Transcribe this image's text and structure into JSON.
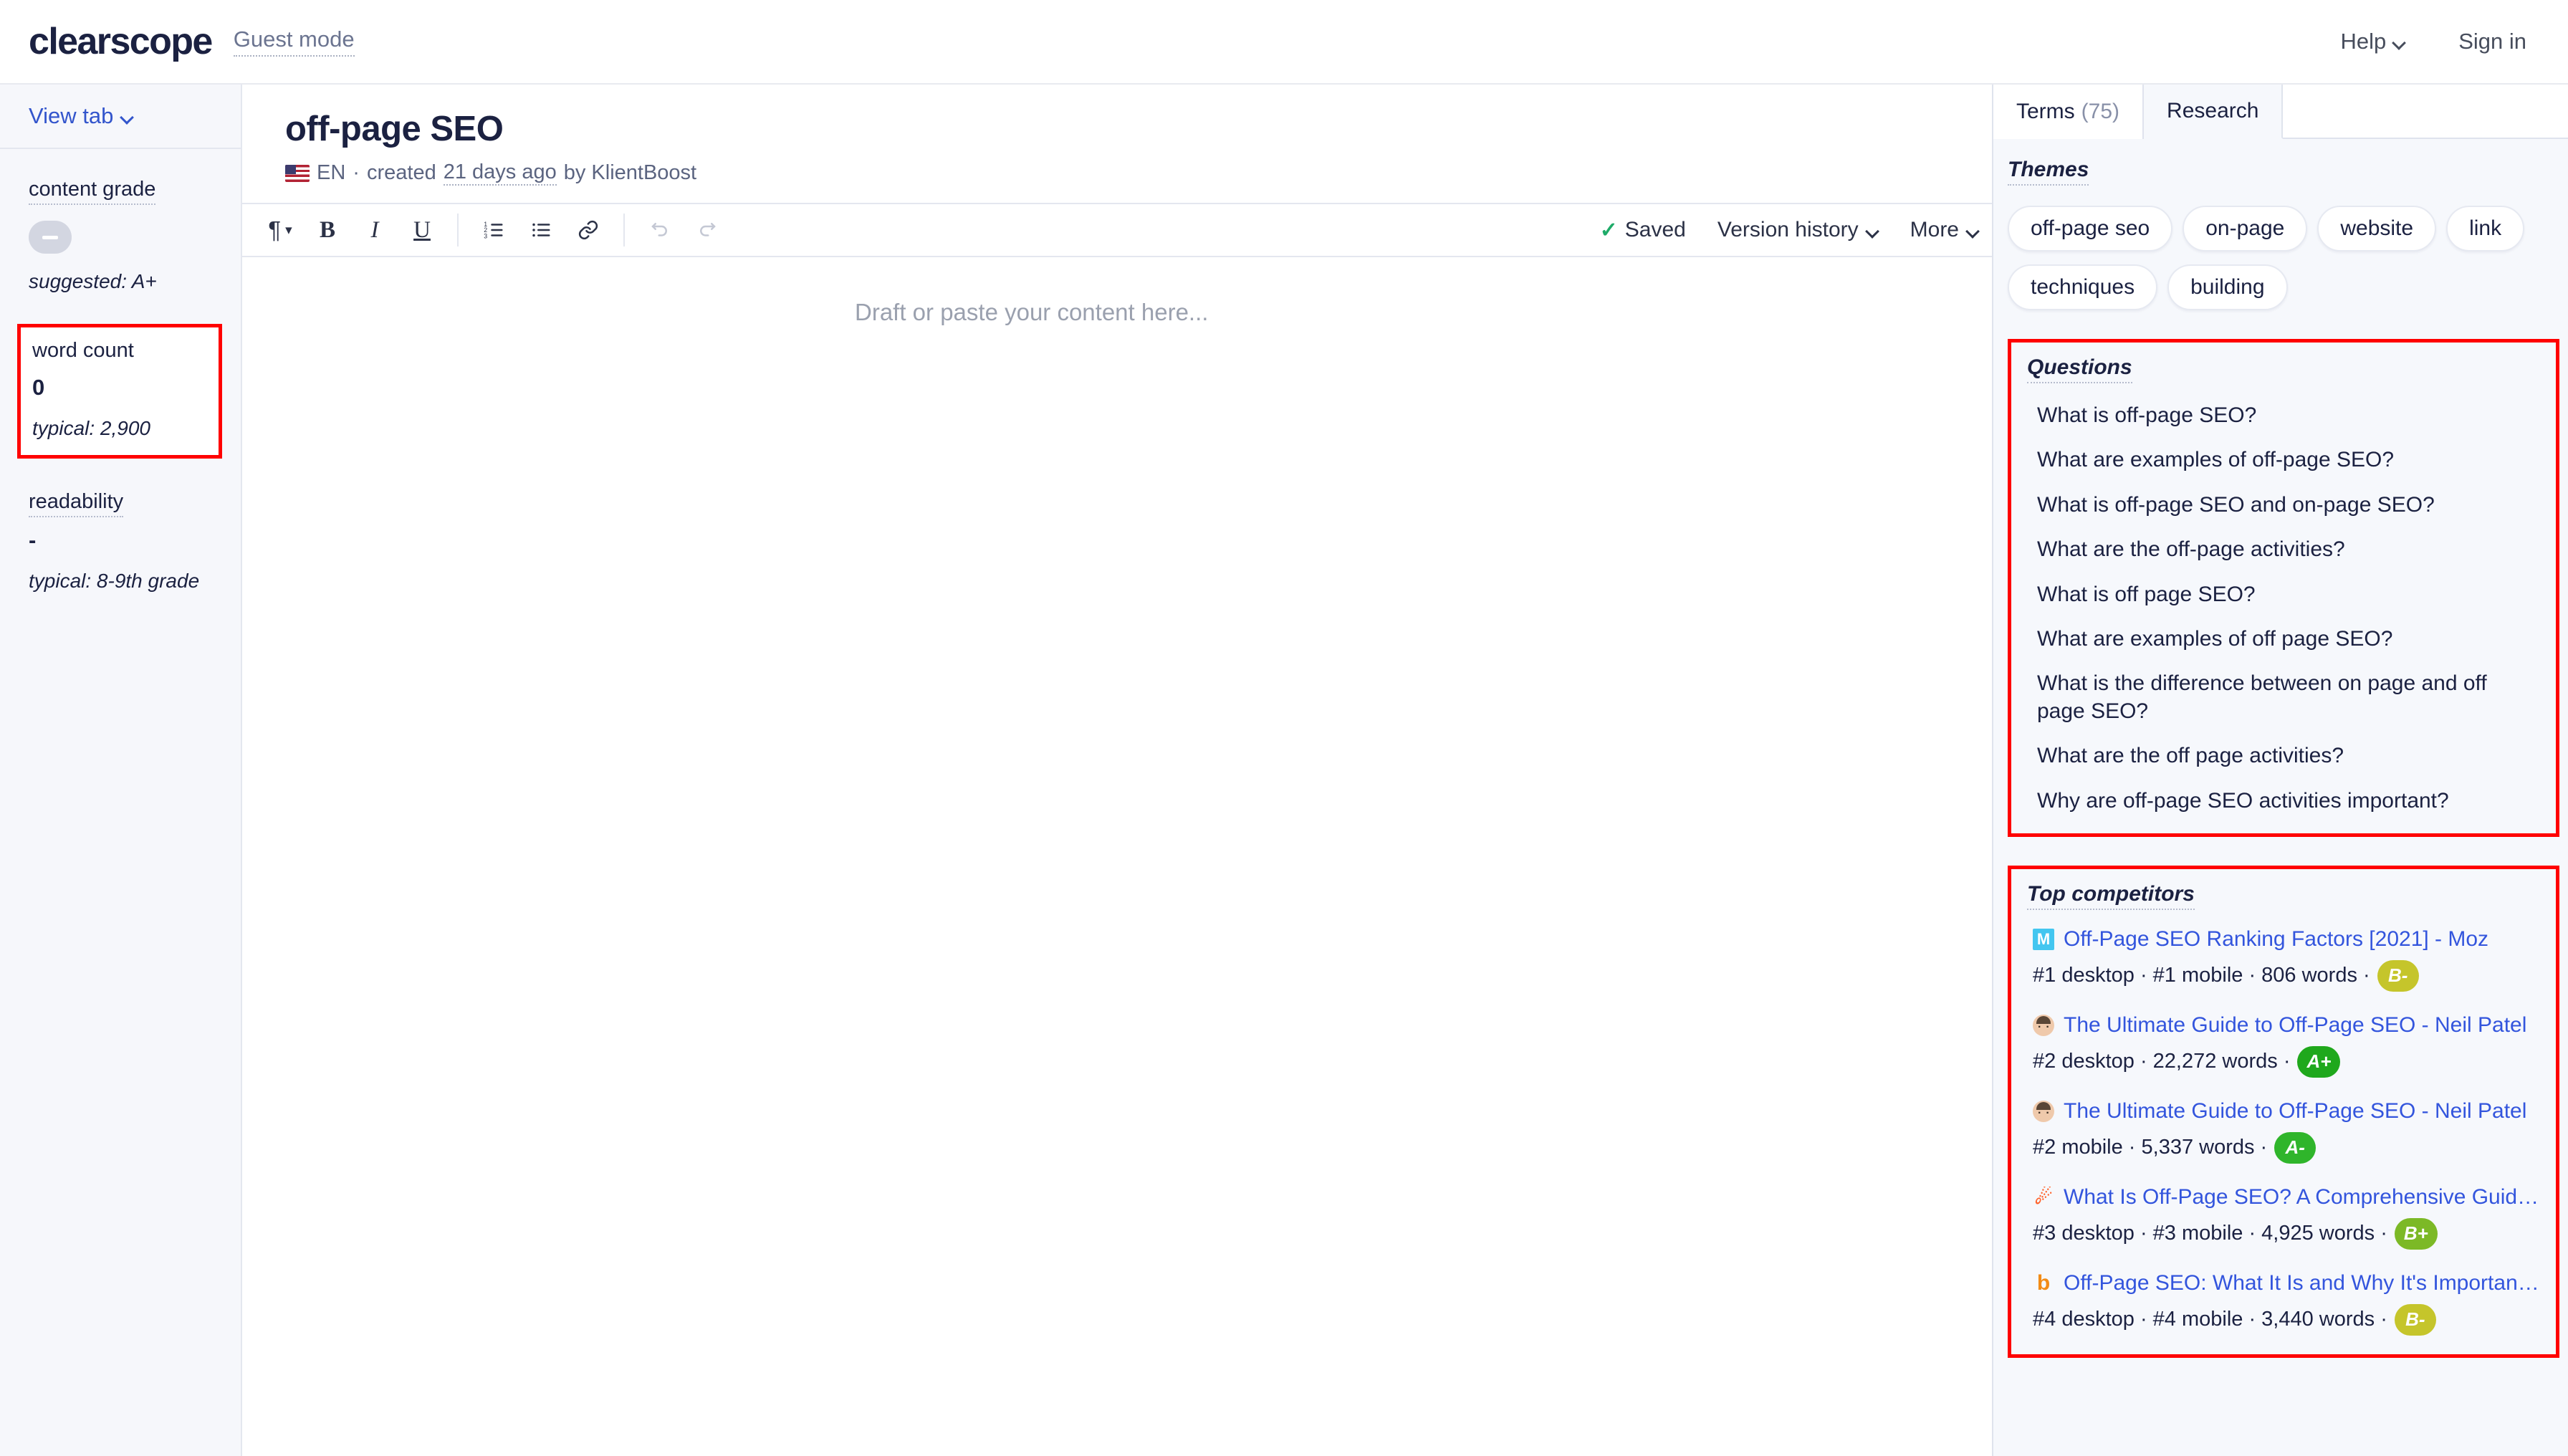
{
  "topbar": {
    "logo": "clearscope",
    "guest_mode": "Guest mode",
    "help": "Help",
    "sign_in": "Sign in"
  },
  "sidebar": {
    "view_tab": "View tab",
    "content_grade": {
      "label": "content grade",
      "grade": "–",
      "suggested": "suggested: A+"
    },
    "word_count": {
      "label": "word count",
      "value": "0",
      "typical": "typical: 2,900"
    },
    "readability": {
      "label": "readability",
      "value": "-",
      "typical": "typical: 8-9th grade"
    }
  },
  "document": {
    "title": "off-page SEO",
    "lang": "EN",
    "sep": "·",
    "created": "created",
    "created_when": "21 days ago",
    "created_by": "by KlientBoost"
  },
  "toolbar": {
    "paragraph": "¶",
    "bold": "B",
    "italic": "I",
    "underline": "U",
    "ordered_list": "ordered-list",
    "bullet_list": "bullet-list",
    "link": "link",
    "undo": "undo",
    "redo": "redo",
    "saved": "Saved",
    "version_history": "Version history",
    "more": "More"
  },
  "editor": {
    "placeholder": "Draft or paste your content here..."
  },
  "right_panel": {
    "tabs": [
      {
        "label": "Terms",
        "count": "(75)",
        "active": false
      },
      {
        "label": "Research",
        "count": "",
        "active": true
      }
    ],
    "themes": {
      "title": "Themes",
      "items": [
        "off-page seo",
        "on-page",
        "website",
        "link",
        "techniques",
        "building"
      ]
    },
    "questions": {
      "title": "Questions",
      "items": [
        "What is off-page SEO?",
        "What are examples of off-page SEO?",
        "What is off-page SEO and on-page SEO?",
        "What are the off-page activities?",
        "What is off page SEO?",
        "What are examples of off page SEO?",
        "What is the difference between on page and off page SEO?",
        "What are the off page activities?",
        "Why are off-page SEO activities important?"
      ]
    },
    "top_competitors": {
      "title": "Top competitors",
      "items": [
        {
          "favicon": "moz-icon",
          "favicon_letter": "M",
          "title": "Off-Page SEO Ranking Factors [2021] - Moz",
          "meta": "#1 desktop · #1 mobile · 806 words ·",
          "grade": "B-",
          "grade_color": "#c5c52b"
        },
        {
          "favicon": "neil-patel-avatar-icon",
          "favicon_letter": "",
          "title": "The Ultimate Guide to Off-Page SEO - Neil Patel",
          "meta": "#2 desktop · 22,272 words ·",
          "grade": "A+",
          "grade_color": "#1fa81c"
        },
        {
          "favicon": "neil-patel-avatar-icon",
          "favicon_letter": "",
          "title": "The Ultimate Guide to Off-Page SEO - Neil Patel",
          "meta": "#2 mobile · 5,337 words ·",
          "grade": "A-",
          "grade_color": "#2fb52b"
        },
        {
          "favicon": "semrush-icon",
          "favicon_letter": "☄",
          "title": "What Is Off-Page SEO? A Comprehensive Guide - ...",
          "meta": "#3 desktop · #3 mobile · 4,925 words ·",
          "grade": "B+",
          "grade_color": "#7cb926"
        },
        {
          "favicon": "backlinko-icon",
          "favicon_letter": "b",
          "title": "Off-Page SEO: What It Is and Why It's Important - ...",
          "meta": "#4 desktop · #4 mobile · 3,440 words ·",
          "grade": "B-",
          "grade_color": "#c5c52b"
        }
      ]
    }
  }
}
